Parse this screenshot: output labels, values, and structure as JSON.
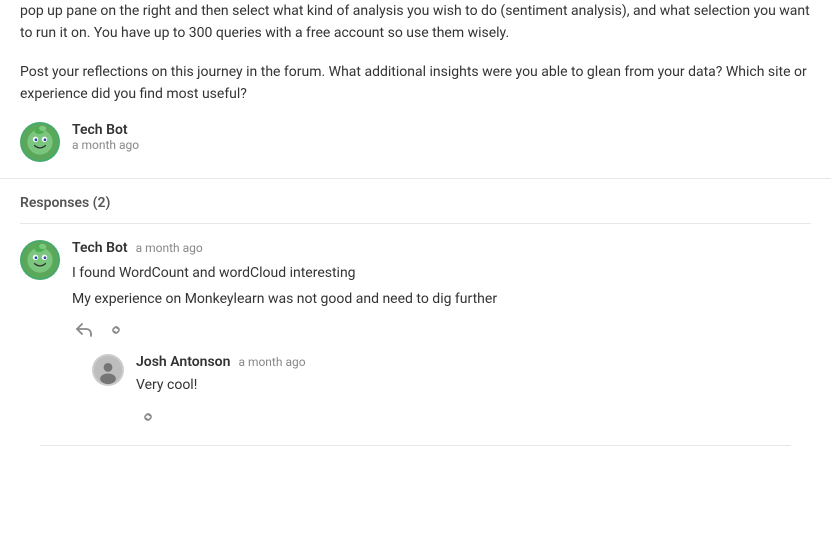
{
  "top": {
    "paragraph1": "pop up pane on the right and then select what kind of analysis you wish to do (sentiment analysis), and what selection you want to run it on. You have up to 300 queries with a free account so use them wisely.",
    "paragraph2": "Post your reflections on this journey in the forum. What additional insights were you able to glean from your data? Which site or experience did you find most useful?",
    "author_name": "Tech Bot",
    "author_time": "a month ago"
  },
  "responses": {
    "header": "Responses (2)",
    "items": [
      {
        "author": "Tech Bot",
        "time": "a month ago",
        "lines": [
          "I found WordCount and wordCloud interesting",
          "My experience on Monkeylearn was not good and need to dig further"
        ],
        "reply": {
          "author": "Josh Antonson",
          "time": "a month ago",
          "text": "Very cool!"
        }
      }
    ]
  },
  "icons": {
    "reply": "↩",
    "link": "🔗"
  }
}
